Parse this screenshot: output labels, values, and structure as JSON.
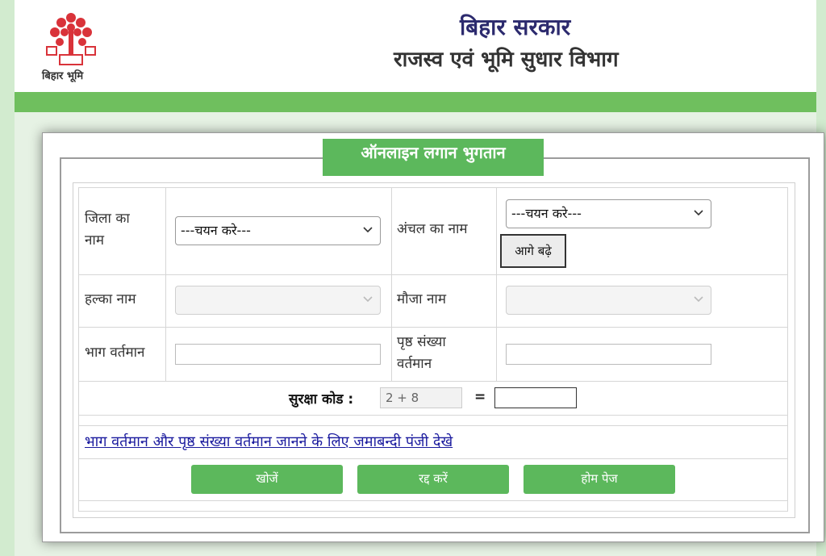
{
  "header": {
    "logo_caption": "बिहार भूमि",
    "gov_title": "बिहार सरकार",
    "dept_title": "राजस्व एवं भूमि सुधार विभाग"
  },
  "form": {
    "title": "ऑनलाइन लगान भुगतान",
    "district_label": "जिला का नाम",
    "district_select": "---चयन करे---",
    "circle_label": "अंचल का नाम",
    "circle_select": "---चयन करे---",
    "next_button": "आगे बढ़े",
    "halka_label": "हल्का नाम",
    "mauza_label": "मौजा नाम",
    "bhag_label": "भाग वर्तमान",
    "page_label": "पृष्ठ संख्या वर्तमान",
    "captcha_label": "सुरक्षा कोड :",
    "captcha_value": "2 + 8",
    "equals": "=",
    "jamabandi_link": "भाग वर्तमान और पृष्ठ संख्या वर्तमान जानने के लिए जमाबन्दी पंजी देखे",
    "search_button": "खोजें",
    "cancel_button": "रद्द करें",
    "home_button": "होम पेज"
  },
  "colors": {
    "accent_green": "#5cb85c",
    "bar_green": "#6fbf5e",
    "title_navy": "#2c2a6e"
  }
}
